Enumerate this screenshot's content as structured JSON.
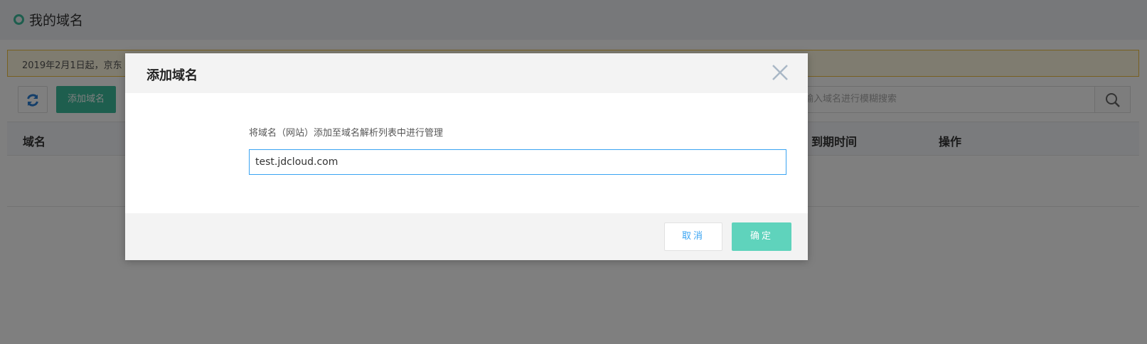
{
  "page": {
    "title": "我的域名",
    "notice": "2019年2月1日起，京东",
    "toolbar": {
      "add_button": "添加域名",
      "search_placeholder": "输入域名进行模糊搜索"
    },
    "table": {
      "headers": [
        "域名",
        "到期时间",
        "操作"
      ]
    }
  },
  "dialog": {
    "title": "添加域名",
    "description": "将域名（网站）添加至域名解析列表中进行管理",
    "domain_value": "test.jdcloud.com",
    "cancel_label": "取消",
    "ok_label": "确定"
  },
  "colors": {
    "brand_green": "#3dbd9d",
    "ok_button": "#5fd3bc",
    "link_blue": "#3aa4f2",
    "notice_border": "#f1c040"
  }
}
